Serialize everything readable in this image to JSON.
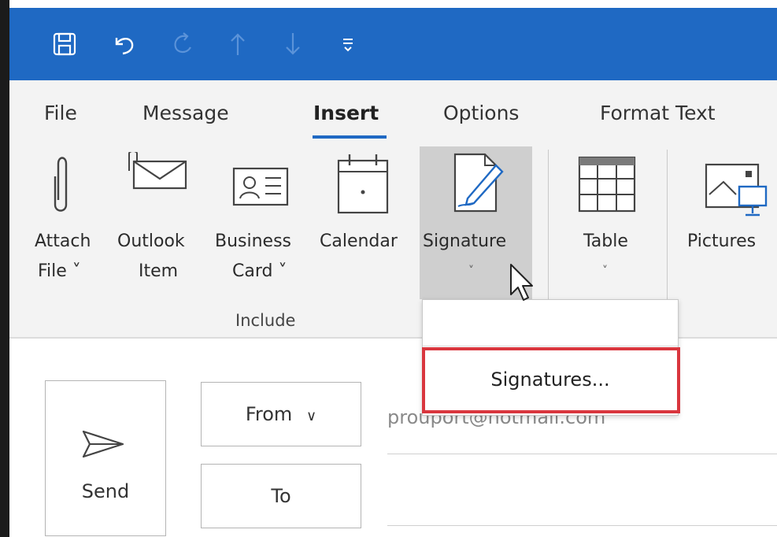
{
  "tabs": [
    "File",
    "Message",
    "Insert",
    "Options",
    "Format Text"
  ],
  "active_tab": "Insert",
  "ribbon": {
    "buttons": [
      {
        "line1": "Attach",
        "line2": "File ˅",
        "icon": "paperclip-icon"
      },
      {
        "line1": "Outlook",
        "line2": "Item",
        "icon": "envelope-clip-icon"
      },
      {
        "line1": "Business",
        "line2": "Card ˅",
        "icon": "business-card-icon"
      },
      {
        "line1": "Calendar",
        "line2": "",
        "icon": "calendar-icon"
      },
      {
        "line1": "Signature",
        "line2": "˅",
        "icon": "signature-pen-icon"
      },
      {
        "line1": "Table",
        "line2": "˅",
        "icon": "table-icon"
      },
      {
        "line1": "Pictures",
        "line2": "",
        "icon": "pictures-icon"
      }
    ],
    "group_label": "Include"
  },
  "dropdown": {
    "item_label": "Signatures..."
  },
  "compose": {
    "send_label": "Send",
    "from_label": "From",
    "to_label": "To",
    "from_value": "prouport@hotmail.com"
  },
  "colors": {
    "titlebar": "#1f69c3",
    "ribbon_bg": "#f3f3f3",
    "highlight_box": "#d9363e"
  }
}
